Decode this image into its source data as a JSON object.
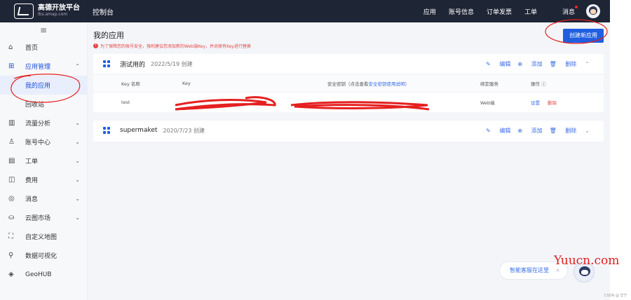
{
  "topbar": {
    "logo_name": "高德开放平台",
    "logo_sub": "lbs.amap.com",
    "console": "控制台",
    "nav": [
      "应用",
      "账号信息",
      "订单发票",
      "工单",
      "消息"
    ]
  },
  "sidebar": {
    "toggle": "≡",
    "items": [
      {
        "icon": "home-icon",
        "label": "首页"
      },
      {
        "icon": "apps-icon",
        "label": "应用管理"
      },
      {
        "label": "我的应用"
      },
      {
        "label": "回收站"
      },
      {
        "icon": "chart-icon",
        "label": "流量分析"
      },
      {
        "icon": "user-icon",
        "label": "账号中心"
      },
      {
        "icon": "ticket-icon",
        "label": "工单"
      },
      {
        "icon": "billing-icon",
        "label": "费用"
      },
      {
        "icon": "message-icon",
        "label": "消息"
      },
      {
        "icon": "market-icon",
        "label": "云图市场"
      },
      {
        "icon": "custom-map-icon",
        "label": "自定义地图"
      },
      {
        "icon": "visual-icon",
        "label": "数据可视化"
      },
      {
        "icon": "geohub-icon",
        "label": "GeoHUB"
      }
    ]
  },
  "main": {
    "title": "我的应用",
    "tip": "为了保障您的账号安全，强烈建议您添加新的Web端Key，并对原有Key进行替换",
    "create_button": "创建新应用",
    "apps": [
      {
        "name": "测试用的",
        "date": "2022/5/19 创建",
        "actions": {
          "edit": "编辑",
          "add": "添加",
          "delete": "删除"
        },
        "columns": {
          "name": "Key 名称",
          "key": "Key",
          "secret_prefix": "安全密钥（点击查看",
          "secret_link": "安全密钥使用说明",
          "secret_suffix": "）",
          "service": "绑定服务",
          "ops": "操作"
        },
        "rows": [
          {
            "name": "test",
            "service": "Web端",
            "set": "设置",
            "del": "删除"
          }
        ]
      },
      {
        "name": "supermaket",
        "date": "2020/7/23 创建",
        "actions": {
          "edit": "编辑",
          "add": "添加",
          "delete": "删除"
        }
      }
    ]
  },
  "help": {
    "label": "智能客服在这里",
    "close": "×"
  },
  "watermark": "Yuucn.com",
  "csdn": "CSDN @ 华宁"
}
